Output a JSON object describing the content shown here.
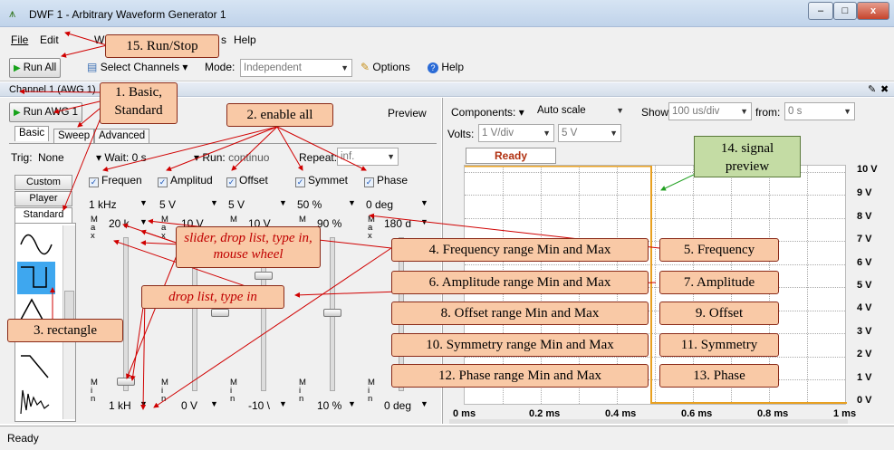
{
  "window": {
    "title": "DWF 1 - Arbitrary Waveform Generator 1",
    "controls": [
      "‒",
      "□",
      "x"
    ]
  },
  "menu": [
    "File",
    "Edit",
    "W",
    "s",
    "Help"
  ],
  "toolbar": {
    "run_all": "Run All",
    "select_channels": "Select Channels",
    "mode_label": "Mode:",
    "mode_value": "Independent",
    "options": "Options",
    "help": "Help"
  },
  "channel": {
    "header": "Channel 1 (AWG 1)",
    "run": "Run  AWG 1",
    "preview": "Preview",
    "tabs": [
      "Basic",
      "Sweep",
      "Advanced"
    ],
    "trig_label": "Trig:",
    "trig_value": "None",
    "wait_label": "Wait:",
    "wait_value": "0 s",
    "run_label": "Run:",
    "run_value": "continuo",
    "repeat_label": "Repeat:",
    "repeat_value": "inf.",
    "side_buttons": [
      "Custom",
      "Player",
      "Standard"
    ],
    "columns": [
      {
        "name": "Frequen",
        "value": "1 kHz",
        "max": "20 k",
        "min": "1 kH"
      },
      {
        "name": "Amplitud",
        "value": "5 V",
        "max": "10 V",
        "min": "0 V"
      },
      {
        "name": "Offset",
        "value": "5 V",
        "max": "10 V",
        "min": "-10 \\"
      },
      {
        "name": "Symmet",
        "value": "50 %",
        "max": "90 %",
        "min": "10 %"
      },
      {
        "name": "Phase",
        "value": "0 deg",
        "max": "180 d",
        "min": "0 deg"
      }
    ],
    "max_letters": [
      "M",
      "a",
      "x"
    ],
    "min_letters": [
      "M",
      "i",
      "n"
    ]
  },
  "preview": {
    "components_label": "Components:",
    "autoscale": "Auto scale",
    "show_label": "Show:",
    "show_value": "100 us/div",
    "from_label": "from:",
    "from_value": "0 s",
    "volts_label": "Volts:",
    "volts_value": "1 V/div",
    "volts_value2": "5 V",
    "ready": "Ready",
    "y_labels": [
      "10 V",
      "9 V",
      "8 V",
      "7 V",
      "6 V",
      "5 V",
      "4 V",
      "3 V",
      "2 V",
      "1 V",
      "0 V"
    ],
    "x_labels": [
      "0 ms",
      "0.2 ms",
      "0.4 ms",
      "0.6 ms",
      "0.8 ms",
      "1 ms"
    ]
  },
  "annotations": {
    "a15": "15. Run/Stop",
    "a1": "1. Basic,\nStandard",
    "a2": "2. enable all",
    "a3": "3.  rectangle",
    "a14": "14. signal\npreview",
    "a4": "4. Frequency range Min and Max",
    "a5": "5. Frequency",
    "a6": "6. Amplitude range Min and Max",
    "a7": "7. Amplitude",
    "a8": "8. Offset range Min and Max",
    "a9": "9. Offset",
    "a10": "10. Symmetry range Min and Max",
    "a11": "11. Symmetry",
    "a12": "12. Phase range Min and Max",
    "a13": "13. Phase",
    "slider": "slider, drop list, type in,\nmouse wheel",
    "droplist": "drop list, type in"
  },
  "status": "Ready",
  "colors": {
    "accent": "#f9c9a6",
    "arrow": "#d00000",
    "signal": "#e8a020",
    "preview_arrow": "#20a020"
  }
}
